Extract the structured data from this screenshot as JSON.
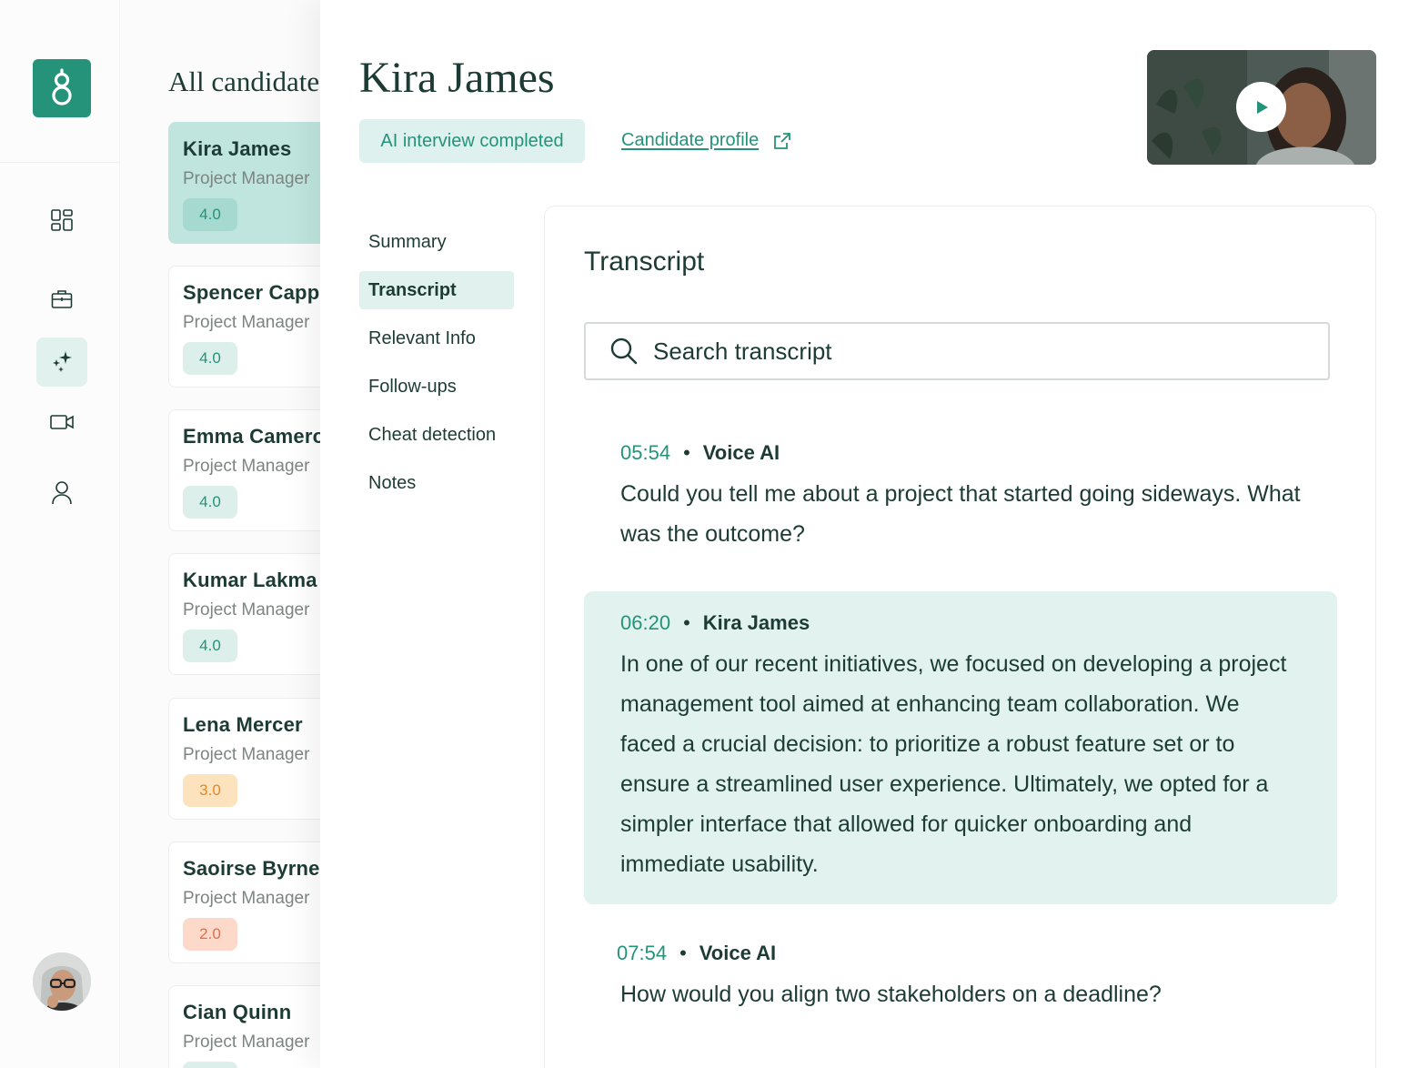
{
  "rail": {
    "logo_icon": "greenhouse-logo-icon",
    "nav": [
      {
        "name": "dashboard-icon",
        "active": false
      },
      {
        "name": "briefcase-icon",
        "active": false
      },
      {
        "name": "sparkles-icon",
        "active": true
      },
      {
        "name": "video-camera-icon",
        "active": false
      },
      {
        "name": "user-icon",
        "active": false
      }
    ],
    "accent": "#24937a"
  },
  "candidates": {
    "title": "All candidates",
    "items": [
      {
        "name": "Kira James",
        "role": "Project Manager",
        "score": "4.0",
        "level": "good",
        "selected": true
      },
      {
        "name": "Spencer Cappa",
        "role": "Project Manager",
        "score": "4.0",
        "level": "good",
        "selected": false
      },
      {
        "name": "Emma Cameron",
        "role": "Project Manager",
        "score": "4.0",
        "level": "good",
        "selected": false
      },
      {
        "name": "Kumar Lakma",
        "role": "Project Manager",
        "score": "4.0",
        "level": "good",
        "selected": false
      },
      {
        "name": "Lena Mercer",
        "role": "Project Manager",
        "score": "3.0",
        "level": "medium",
        "selected": false
      },
      {
        "name": "Saoirse Byrne",
        "role": "Project Manager",
        "score": "2.0",
        "level": "low",
        "selected": false
      },
      {
        "name": "Cian Quinn",
        "role": "Project Manager",
        "score": "",
        "level": "good",
        "selected": false
      }
    ]
  },
  "detail": {
    "name": "Kira James",
    "status": "AI interview completed",
    "profile_link": "Candidate profile",
    "tabs": [
      {
        "label": "Summary",
        "active": false
      },
      {
        "label": "Transcript",
        "active": true
      },
      {
        "label": "Relevant Info",
        "active": false
      },
      {
        "label": "Follow-ups",
        "active": false
      },
      {
        "label": "Cheat detection",
        "active": false
      },
      {
        "label": "Notes",
        "active": false
      }
    ]
  },
  "transcript": {
    "title": "Transcript",
    "search_placeholder": "Search transcript",
    "entries": [
      {
        "time": "05:54",
        "speaker": "Voice AI",
        "text": "Could you tell me about a project that started going sideways. What was the outcome?",
        "highlighted": false
      },
      {
        "time": "06:20",
        "speaker": "Kira James",
        "text": "In one of our recent initiatives, we focused on developing a project management tool aimed at enhancing team collaboration. We faced a crucial decision: to prioritize a robust feature set or to ensure a streamlined user experience. Ultimately, we opted for a simpler interface that allowed for quicker onboarding and immediate usability.",
        "highlighted": true
      },
      {
        "time": "07:54",
        "speaker": "Voice AI",
        "text": "How would you align two stakeholders on a deadline?",
        "highlighted": false
      }
    ]
  }
}
